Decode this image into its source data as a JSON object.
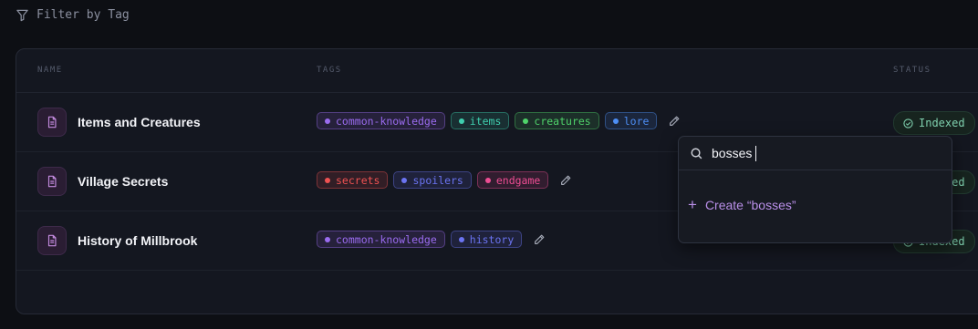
{
  "filter": {
    "label": "Filter by Tag",
    "icon": "funnel-icon"
  },
  "table": {
    "headers": {
      "name": "NAME",
      "tags": "TAGS",
      "status": "STATUS"
    },
    "rows": [
      {
        "name": "Items and Creatures",
        "icon": "document-icon",
        "tags": [
          {
            "label": "common-knowledge",
            "color": "#9b6cf0"
          },
          {
            "label": "items",
            "color": "#3fcfae"
          },
          {
            "label": "creatures",
            "color": "#4fd36a"
          },
          {
            "label": "lore",
            "color": "#4d8ef5"
          }
        ],
        "status": "Indexed"
      },
      {
        "name": "Village Secrets",
        "icon": "document-icon",
        "tags": [
          {
            "label": "secrets",
            "color": "#f05252"
          },
          {
            "label": "spoilers",
            "color": "#6b74f2"
          },
          {
            "label": "endgame",
            "color": "#ef4d93"
          }
        ],
        "status": "Indexed"
      },
      {
        "name": "History of Millbrook",
        "icon": "document-icon",
        "tags": [
          {
            "label": "common-knowledge",
            "color": "#9b6cf0"
          },
          {
            "label": "history",
            "color": "#6b74f2"
          }
        ],
        "status": "Indexed"
      }
    ]
  },
  "tag_popup": {
    "search_value": "bosses",
    "create_label": "Create “bosses”",
    "create_icon": "plus-icon"
  },
  "colors": {
    "accent": "#b98fe8",
    "status_green": "#7fd0ae",
    "background": "#0d0f14",
    "panel": "#141720"
  }
}
